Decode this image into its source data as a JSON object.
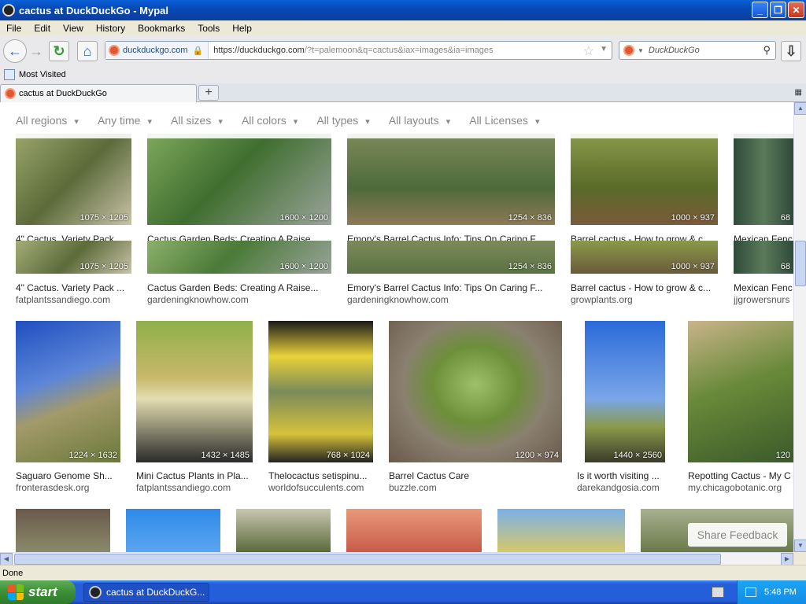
{
  "window": {
    "title": "cactus at DuckDuckGo - Mypal",
    "buttons": {
      "minimize": "_",
      "maximize": "❐",
      "close": "✕"
    }
  },
  "menu": [
    "File",
    "Edit",
    "View",
    "History",
    "Bookmarks",
    "Tools",
    "Help"
  ],
  "nav": {
    "identity": "duckduckgo.com",
    "url_host": "https://duckduckgo.com",
    "url_rest": "/?t=palemoon&q=cactus&iax=images&ia=images",
    "search_placeholder": "DuckDuckGo"
  },
  "bookmarks": {
    "most_visited": "Most Visited"
  },
  "tabs": [
    {
      "label": "cactus at DuckDuckGo"
    }
  ],
  "new_tab": "+",
  "filters": [
    "All regions",
    "Any time",
    "All sizes",
    "All colors",
    "All types",
    "All layouts",
    "All Licenses"
  ],
  "row0": {
    "dims": [
      "1075 × 1205",
      "1600 × 1200",
      "1254 × 836",
      "1000 × 937",
      "68"
    ],
    "captions": [
      "4\" Cactus. Variety Pack",
      "Cactus Garden Beds: Creating A Raise",
      "Emory's Barrel Cactus Info: Tips On Caring F",
      "Barrel cactus - How to grow & c",
      "Mexican Fenc"
    ]
  },
  "row1": {
    "dims": [
      "1075 × 1205",
      "1600 × 1200",
      "1254 × 836",
      "1000 × 937",
      "68"
    ],
    "captions": [
      "4\" Cactus. Variety Pack ...",
      "Cactus Garden Beds: Creating A Raise...",
      "Emory's Barrel Cactus Info: Tips On Caring F...",
      "Barrel cactus - How to grow & c...",
      "Mexican Fenc"
    ],
    "sources": [
      "fatplantssandiego.com",
      "gardeningknowhow.com",
      "gardeningknowhow.com",
      "growplants.org",
      "jjgrowersnurs"
    ]
  },
  "row2": {
    "dims": [
      "1224 × 1632",
      "1432 × 1485",
      "768 × 1024",
      "1200 × 974",
      "1440 × 2560",
      "120"
    ],
    "captions": [
      "Saguaro Genome Sh...",
      "Mini Cactus Plants in Pla...",
      "Thelocactus setispinu...",
      "Barrel Cactus Care",
      "Is it worth visiting ...",
      "Repotting Cactus - My C"
    ],
    "sources": [
      "fronterasdesk.org",
      "fatplantssandiego.com",
      "worldofsucculents.com",
      "buzzle.com",
      "darekandgosia.com",
      "my.chicagobotanic.org"
    ]
  },
  "share_feedback": "Share Feedback",
  "status": "Done",
  "taskbar": {
    "start": "start",
    "task": "cactus at DuckDuckG...",
    "clock": "5:48 PM"
  }
}
